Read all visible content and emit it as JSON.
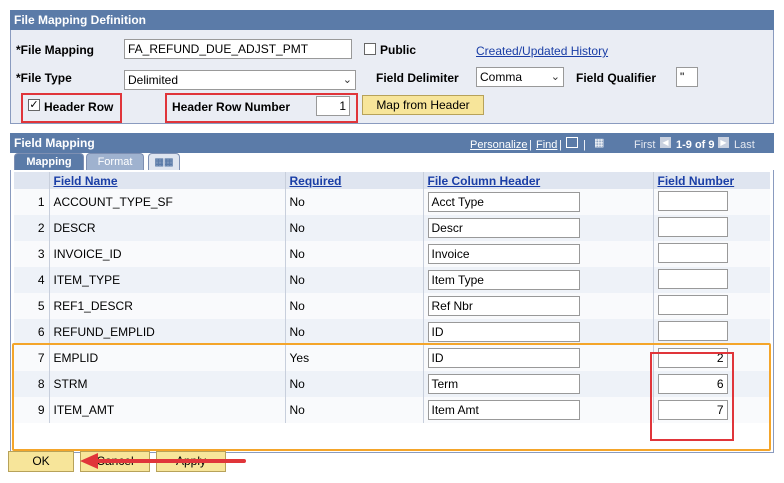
{
  "file_mapping_definition": {
    "title": "File Mapping Definition",
    "file_mapping_label": "*File Mapping",
    "file_mapping_value": "FA_REFUND_DUE_ADJST_PMT",
    "public_label": "Public",
    "history_link": "Created/Updated History",
    "file_type_label": "*File Type",
    "file_type_value": "Delimited",
    "field_delimiter_label": "Field Delimiter",
    "field_delimiter_value": "Comma",
    "field_qualifier_label": "Field Qualifier",
    "field_qualifier_value": "\"",
    "header_row_label": "Header Row",
    "header_row_number_label": "Header Row Number",
    "header_row_number_value": "1",
    "map_from_header_button": "Map from Header"
  },
  "field_mapping": {
    "title": "Field Mapping",
    "personalize": "Personalize",
    "find": "Find",
    "first": "First",
    "range": "1-9 of 9",
    "last": "Last",
    "tabs": [
      "Mapping",
      "Format"
    ],
    "columns": [
      "Field Name",
      "Required",
      "File Column Header",
      "Field Number"
    ],
    "rows": [
      {
        "num": "1",
        "field": "ACCOUNT_TYPE_SF",
        "required": "No",
        "header": "Acct Type",
        "number": ""
      },
      {
        "num": "2",
        "field": "DESCR",
        "required": "No",
        "header": "Descr",
        "number": ""
      },
      {
        "num": "3",
        "field": "INVOICE_ID",
        "required": "No",
        "header": "Invoice",
        "number": ""
      },
      {
        "num": "4",
        "field": "ITEM_TYPE",
        "required": "No",
        "header": "Item Type",
        "number": ""
      },
      {
        "num": "5",
        "field": "REF1_DESCR",
        "required": "No",
        "header": "Ref Nbr",
        "number": ""
      },
      {
        "num": "6",
        "field": "REFUND_EMPLID",
        "required": "No",
        "header": "ID",
        "number": ""
      },
      {
        "num": "7",
        "field": "EMPLID",
        "required": "Yes",
        "header": "ID",
        "number": "2"
      },
      {
        "num": "8",
        "field": "STRM",
        "required": "No",
        "header": "Term",
        "number": "6"
      },
      {
        "num": "9",
        "field": "ITEM_AMT",
        "required": "No",
        "header": "Item Amt",
        "number": "7"
      }
    ]
  },
  "buttons": {
    "ok": "OK",
    "cancel": "Cancel",
    "apply": "Apply"
  },
  "colors": {
    "header_bg": "#5b7ba8",
    "highlight_red": "#e0353a",
    "highlight_orange": "#f4a52a",
    "button_bg": "#f7e59a"
  }
}
